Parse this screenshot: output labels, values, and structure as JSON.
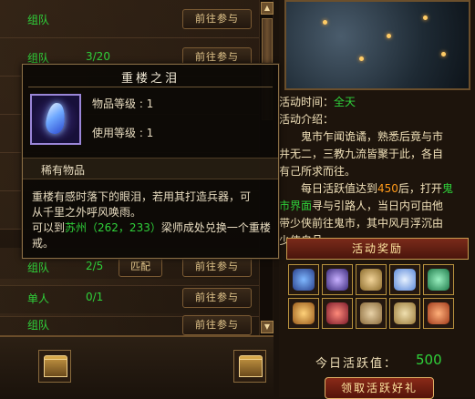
{
  "list": {
    "rows": [
      {
        "mode": "组队",
        "count": "",
        "go_label": "前往参与"
      },
      {
        "mode": "组队",
        "count": "3/20",
        "go_label": "前往参与"
      },
      {
        "mode": "",
        "count": "",
        "go_label": ""
      },
      {
        "mode": "",
        "count": "",
        "go_label": ""
      },
      {
        "mode": "",
        "count": "",
        "go_label": ""
      },
      {
        "mode": "",
        "count": "",
        "go_label": ""
      },
      {
        "mode": "组队",
        "count": "2/5",
        "go_label": "前往参与",
        "extra_label": "匹配"
      },
      {
        "mode": "单人",
        "count": "0/1",
        "go_label": "前往参与"
      },
      {
        "mode": "组队",
        "count": "",
        "go_label": "前往参与"
      }
    ]
  },
  "tooltip": {
    "title": "重楼之泪",
    "item_level": "物品等级 : 1",
    "use_level": "使用等级 : 1",
    "rarity": "稀有物品",
    "desc_line1": "重楼有感时落下的眼泪，若用其打造兵器，可",
    "desc_line2": "从千里之外呼风唤雨。",
    "desc_line3_prefix": "可以到",
    "desc_line3_place": "苏州",
    "desc_line3_coord": "（262，233）",
    "desc_line3_suffix": "梁师成处兑换一个重楼",
    "desc_line4": "戒。"
  },
  "right": {
    "time_label": "活动时间：",
    "time_value": "全天",
    "intro_label": "活动介绍：",
    "intro_lines": [
      "鬼市乍闻诡谲，熟悉后竟与市",
      "井无二，三教九流皆聚于此，各自",
      "有己所求而往。"
    ],
    "activity_line_prefix": "每日活跃值达到",
    "activity_line_num": "450",
    "activity_line_suffix": "后，打开",
    "activity_line_suffix2": "鬼",
    "guide_line_prefix": "市界面",
    "guide_line_suffix": "寻与引路人，当日内可由他",
    "guide_line2": "带少侠前往鬼市，其中风月浮沉由",
    "guide_line3": "少侠自品。",
    "reward_header": "活动奖励",
    "activity_label": "今日活跃值：",
    "activity_value": "500",
    "claim_button": "领取活跃好礼"
  },
  "colors": {
    "accent_green": "#2fd13a",
    "accent_orange": "#ff9a1a",
    "gold_border": "#b8923e"
  }
}
